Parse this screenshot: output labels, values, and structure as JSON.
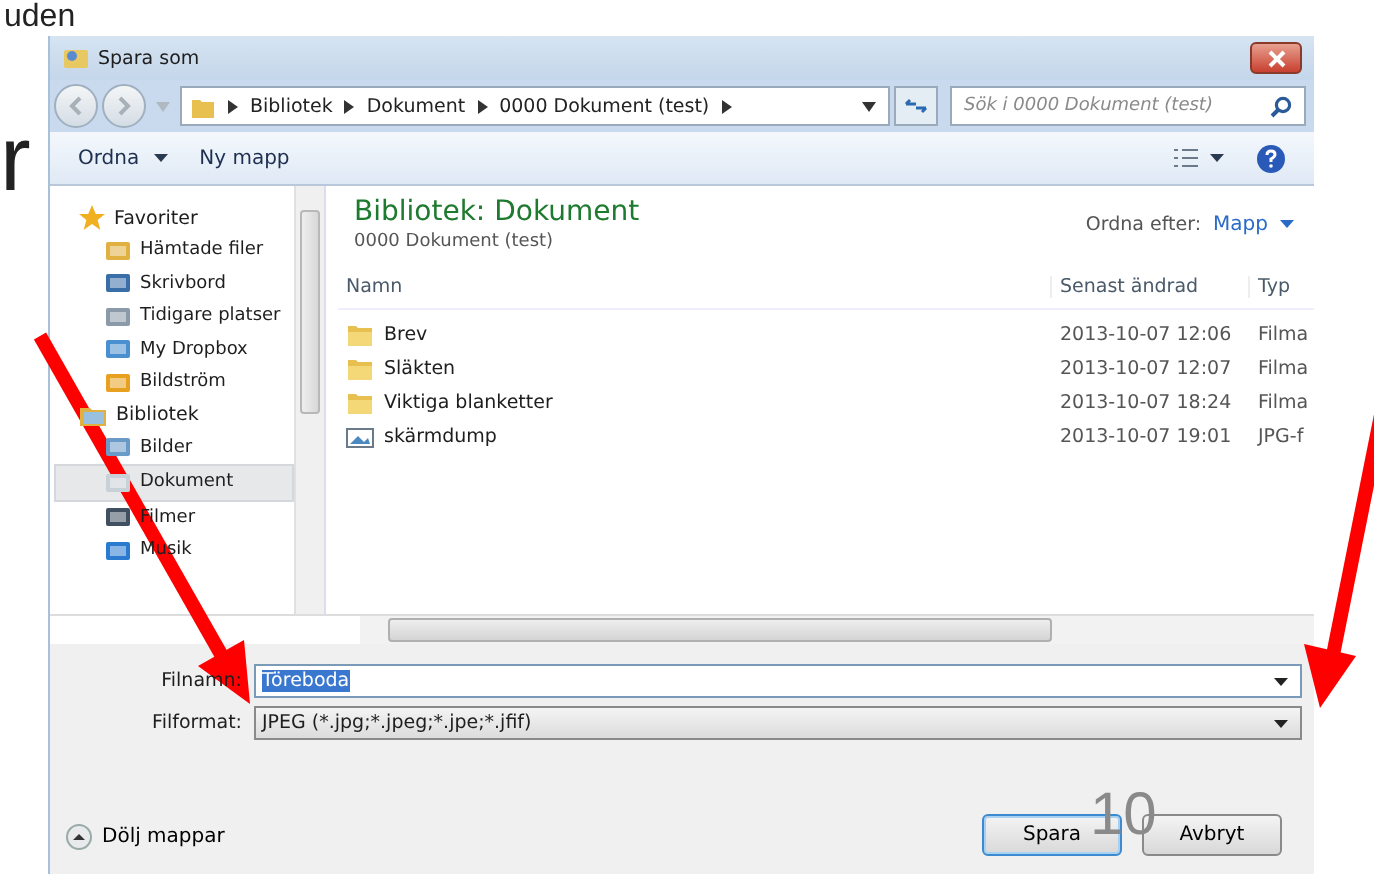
{
  "slide": {
    "text_fragments": [
      "uden",
      "r"
    ],
    "page_number": "10"
  },
  "window": {
    "title": "Spara som"
  },
  "address_bar": {
    "path": [
      "Bibliotek",
      "Dokument",
      "0000 Dokument (test)"
    ]
  },
  "search": {
    "placeholder": "Sök i 0000 Dokument (test)"
  },
  "toolbar": {
    "buttons": [
      {
        "label": "Ordna",
        "kind": "menu"
      },
      {
        "label": "Ny mapp",
        "kind": "plain"
      }
    ]
  },
  "sidebar": {
    "groups": [
      {
        "label": "Favoriter",
        "kind": "favorites",
        "children": [
          {
            "label": "Hämtade filer",
            "kind": "downloads",
            "selected": false
          },
          {
            "label": "Skrivbord",
            "kind": "desktop",
            "selected": false
          },
          {
            "label": "Tidigare platser",
            "kind": "recent",
            "selected": false
          },
          {
            "label": "My Dropbox",
            "kind": "dropbox",
            "selected": false
          },
          {
            "label": "Bildström",
            "kind": "photostream",
            "selected": false
          }
        ]
      },
      {
        "label": "Bibliotek",
        "kind": "libraries",
        "children": [
          {
            "label": "Bilder",
            "kind": "pictures",
            "selected": false
          },
          {
            "label": "Dokument",
            "kind": "documents",
            "selected": true
          },
          {
            "label": "Filmer",
            "kind": "videos",
            "selected": false
          },
          {
            "label": "Musik",
            "kind": "music",
            "selected": false
          }
        ]
      }
    ]
  },
  "library": {
    "title": "Bibliotek: Dokument",
    "subtitle": "0000 Dokument (test)",
    "arrange_label": "Ordna efter:",
    "arrange_value": "Mapp"
  },
  "table": {
    "columns": [
      "Namn",
      "Senast ändrad",
      "Typ"
    ],
    "rows": [
      {
        "kind": "folder",
        "name": "Brev",
        "modified": "2013-10-07 12:06",
        "type": "Filma"
      },
      {
        "kind": "folder",
        "name": "Släkten",
        "modified": "2013-10-07 12:07",
        "type": "Filma"
      },
      {
        "kind": "folder",
        "name": "Viktiga blanketter",
        "modified": "2013-10-07 18:24",
        "type": "Filma"
      },
      {
        "kind": "image",
        "name": "skärmdump",
        "modified": "2013-10-07 19:01",
        "type": "JPG-f"
      }
    ]
  },
  "form": {
    "filename_label": "Filnamn:",
    "filename": "Töreboda",
    "filename_text_selected": true,
    "format_label": "Filformat:",
    "format": "JPEG (*.jpg;*.jpeg;*.jpe;*.jfif)"
  },
  "footer": {
    "toggle": "Dölj mappar",
    "buttons": [
      {
        "label": "Spara",
        "default": true
      },
      {
        "label": "Avbryt",
        "default": false
      }
    ]
  }
}
